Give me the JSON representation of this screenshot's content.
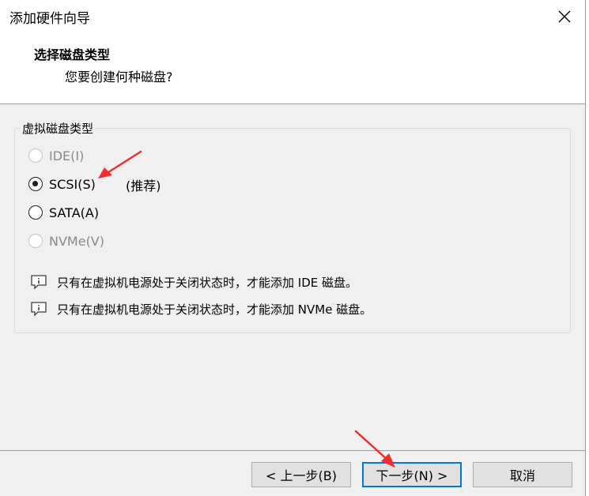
{
  "window": {
    "title": "添加硬件向导"
  },
  "header": {
    "title": "选择磁盘类型",
    "subtitle": "您要创建何种磁盘?"
  },
  "group": {
    "legend": "虚拟磁盘类型",
    "options": [
      {
        "label": "IDE(I)",
        "selected": false,
        "enabled": false
      },
      {
        "label": "SCSI(S)",
        "selected": true,
        "enabled": true,
        "note": "(推荐)"
      },
      {
        "label": "SATA(A)",
        "selected": false,
        "enabled": true
      },
      {
        "label": "NVMe(V)",
        "selected": false,
        "enabled": false
      }
    ],
    "notes": [
      "只有在虚拟机电源处于关闭状态时，才能添加 IDE 磁盘。",
      "只有在虚拟机电源处于关闭状态时，才能添加 NVMe 磁盘。"
    ]
  },
  "buttons": {
    "back": "< 上一步(B)",
    "next": "下一步(N) >",
    "cancel": "取消"
  },
  "colors": {
    "arrow": "#f02d2d",
    "default_button_border": "#0078d7",
    "panel_bg": "#f0f0f0"
  }
}
